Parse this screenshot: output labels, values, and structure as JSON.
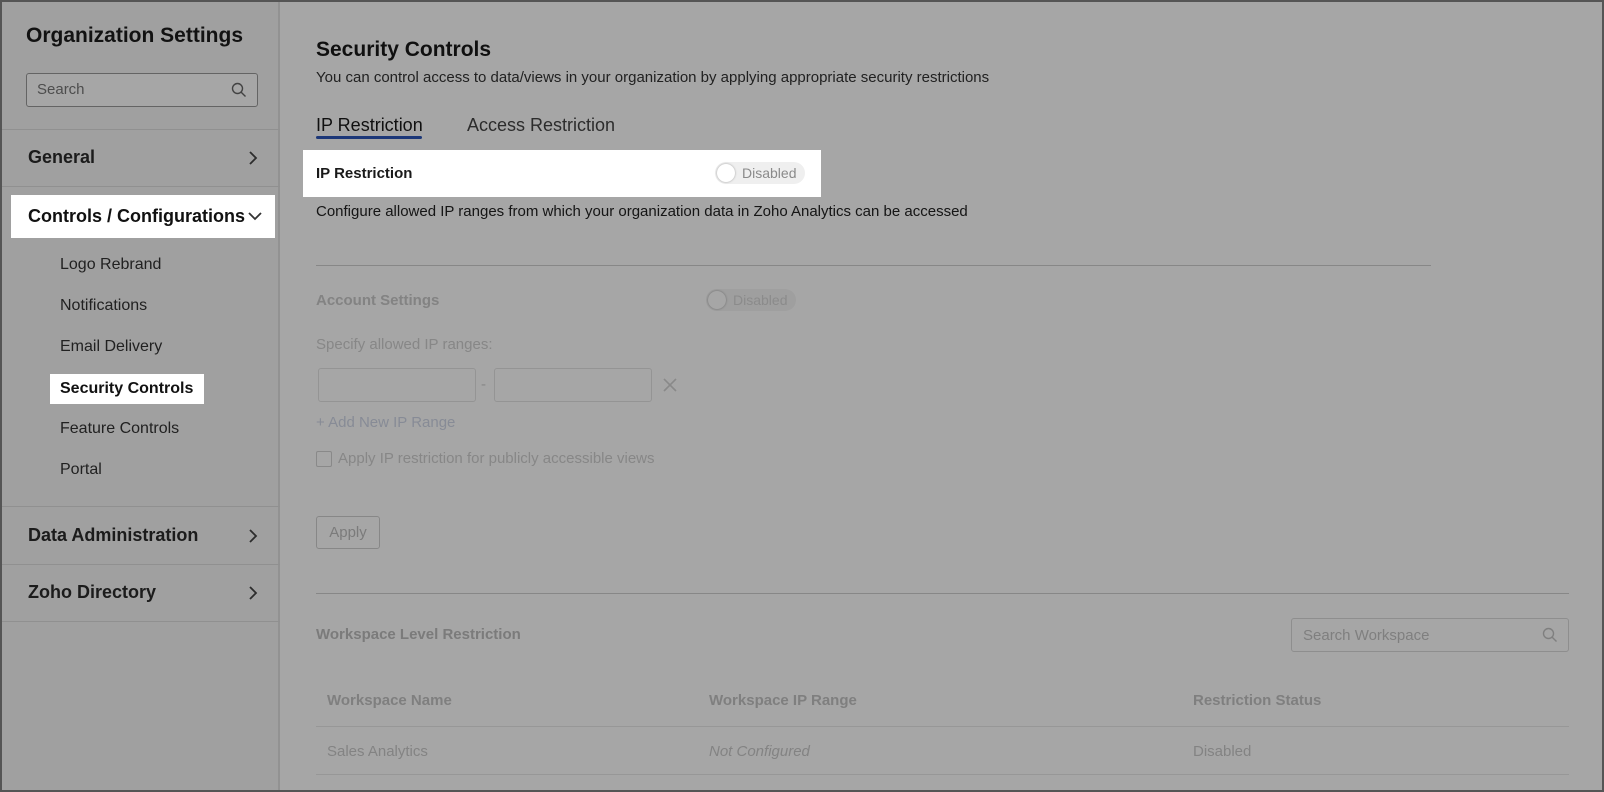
{
  "sidebar": {
    "title": "Organization Settings",
    "search_placeholder": "Search",
    "sections": [
      {
        "label": "General"
      },
      {
        "label": "Controls / Configurations"
      },
      {
        "label": "Data Administration"
      },
      {
        "label": "Zoho Directory"
      }
    ],
    "sub_items": [
      "Logo Rebrand",
      "Notifications",
      "Email Delivery",
      "Security Controls",
      "Feature Controls",
      "Portal"
    ]
  },
  "main": {
    "title": "Security Controls",
    "subtitle": "You can control access to data/views in your organization by applying appropriate security restrictions",
    "tabs": [
      {
        "label": "IP Restriction",
        "active": true
      },
      {
        "label": "Access Restriction",
        "active": false
      }
    ],
    "ip_restriction": {
      "label": "IP Restriction",
      "toggle_state": "Disabled",
      "description": "Configure allowed IP ranges from which your organization data in Zoho Analytics can be accessed"
    },
    "account_settings": {
      "label": "Account Settings",
      "toggle_state": "Disabled",
      "specify_label": "Specify allowed IP ranges:",
      "range_separator": "-",
      "add_range": "+ Add New IP Range",
      "checkbox_label": "Apply IP restriction for publicly accessible views",
      "apply_button": "Apply"
    },
    "workspace": {
      "title": "Workspace Level Restriction",
      "search_placeholder": "Search Workspace",
      "columns": [
        "Workspace Name",
        "Workspace IP Range",
        "Restriction Status"
      ],
      "rows": [
        {
          "name": "Sales Analytics",
          "range": "Not Configured",
          "status": "Disabled"
        }
      ]
    }
  },
  "icons": {
    "search": "search-icon",
    "chevron_right": "chevron-right-icon",
    "chevron_down": "chevron-down-icon",
    "close": "close-icon"
  },
  "colors": {
    "tab_underline": "#2c55b8",
    "overlay": "rgba(0,0,0,0.35)"
  }
}
